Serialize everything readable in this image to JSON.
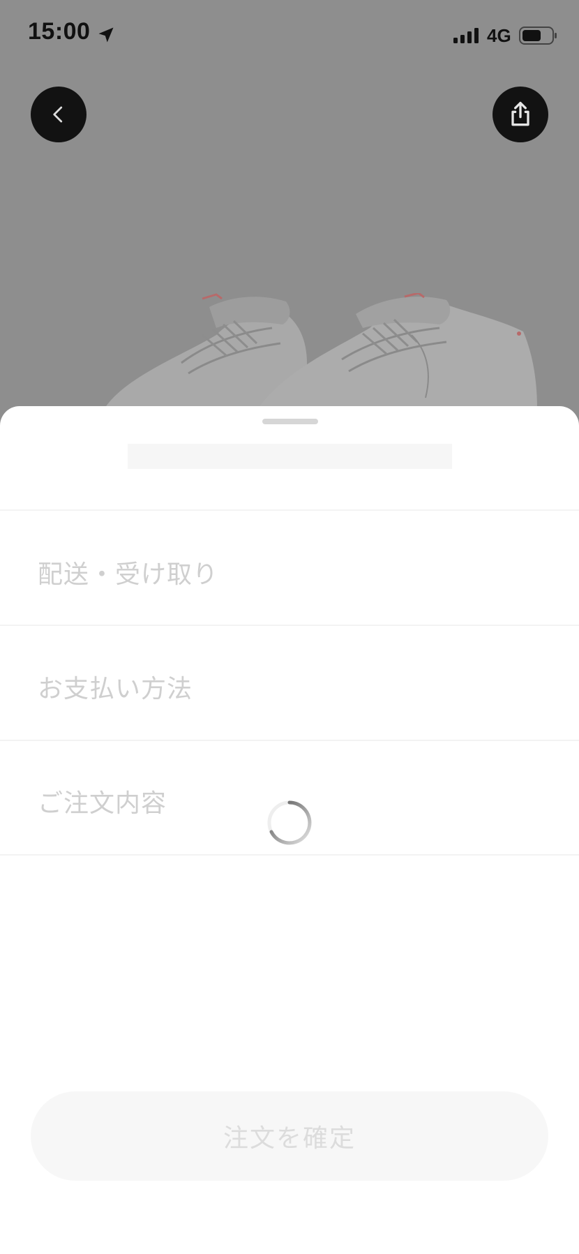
{
  "status_bar": {
    "time": "15:00",
    "network": "4G",
    "icons": [
      "location-arrow-icon",
      "signal-bars-icon",
      "battery-icon"
    ]
  },
  "header": {
    "back_icon": "chevron-left-icon",
    "share_icon": "share-icon"
  },
  "sheet": {
    "sections": [
      {
        "label": "配送・受け取り"
      },
      {
        "label": "お支払い方法"
      },
      {
        "label": "ご注文内容"
      }
    ],
    "confirm_label": "注文を確定",
    "loading": true
  },
  "colors": {
    "overlay": "#8e8e8e",
    "button_dark": "#121212",
    "muted_text": "#cfcfcf",
    "disabled_button": "#f7f7f7"
  }
}
